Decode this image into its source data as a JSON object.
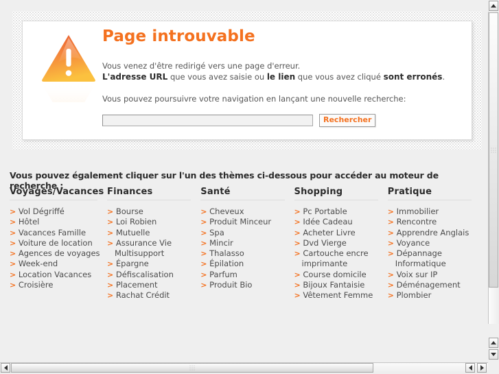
{
  "error_panel": {
    "icon": "warning-triangle-icon",
    "title": "Page introuvable",
    "paragraph": {
      "line1": "Vous venez d'être redirigé vers une page d'erreur.",
      "line2_bold1": "L'adresse URL",
      "line2_mid1": " que vous avez saisie ou ",
      "line2_bold2": "le lien",
      "line2_mid2": " que vous avez cliqué ",
      "line2_bold3": "sont erronés",
      "line2_end": "."
    },
    "prompt": "Vous pouvez poursuivre votre navigation en lançant une nouvelle recherche:",
    "search": {
      "value": "",
      "placeholder": "",
      "button_label": "Rechercher"
    }
  },
  "themes": {
    "intro": "Vous pouvez également cliquer sur l'un des thèmes ci-dessous pour accéder au moteur de recherche :",
    "arrow_glyph": ">",
    "columns": [
      {
        "title": "Voyages/Vacances",
        "items": [
          "Vol Dégriffé",
          "Hôtel",
          "Vacances Famille",
          "Voiture de location",
          "Agences de voyages",
          "Week-end",
          "Location Vacances",
          "Croisière"
        ]
      },
      {
        "title": "Finances",
        "items": [
          "Bourse",
          "Loi Robien",
          "Mutuelle",
          "Assurance Vie Multisupport",
          "Épargne",
          "Défiscalisation",
          "Placement",
          "Rachat Crédit"
        ]
      },
      {
        "title": "Santé",
        "items": [
          "Cheveux",
          "Produit Minceur",
          "Spa",
          "Mincir",
          "Thalasso",
          "Épilation",
          "Parfum",
          "Produit Bio"
        ]
      },
      {
        "title": "Shopping",
        "items": [
          "Pc Portable",
          "Idée Cadeau",
          "Acheter Livre",
          "Dvd Vierge",
          "Cartouche encre imprimante",
          "Course domicile",
          "Bijoux Fantaisie",
          "Vêtement Femme"
        ]
      },
      {
        "title": "Pratique",
        "items": [
          "Immobilier",
          "Rencontre",
          "Apprendre Anglais",
          "Voyance",
          "Dépannage Informatique",
          "Voix sur IP",
          "Déménagement",
          "Plombier"
        ]
      }
    ]
  },
  "scrollbars": {
    "vertical": {
      "up_icon": "triangle-up-icon",
      "down_icon": "triangle-down-icon",
      "grip_icon": "grip-dots-icon"
    },
    "horizontal": {
      "left_icon": "triangle-left-icon",
      "right_icon": "triangle-right-icon",
      "grip_icon": "grip-dots-icon"
    }
  },
  "colors": {
    "accent_orange": "#f4711f",
    "page_background": "#efefef",
    "panel_background": "#ffffff",
    "text_dark": "#2b2b2b",
    "text_body": "#4b4b4b"
  }
}
